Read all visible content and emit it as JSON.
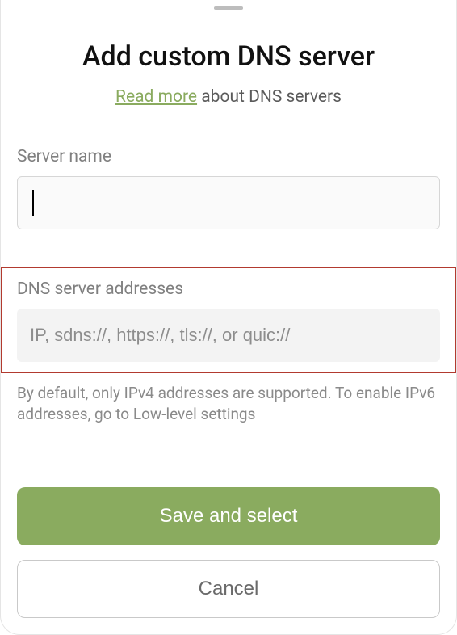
{
  "title": "Add custom DNS server",
  "subtitle": {
    "link_text": "Read more",
    "rest_text": " about DNS servers"
  },
  "server_name": {
    "label": "Server name",
    "value": ""
  },
  "dns_addresses": {
    "label": "DNS server addresses",
    "placeholder": "IP, sdns://, https://, tls://, or quic://",
    "value": ""
  },
  "helper_text": "By default, only IPv4 addresses are supported. To enable IPv6 addresses, go to Low-level settings",
  "buttons": {
    "primary": "Save and select",
    "secondary": "Cancel"
  },
  "colors": {
    "accent": "#8aab5f",
    "highlight_border": "#b23a2f"
  }
}
